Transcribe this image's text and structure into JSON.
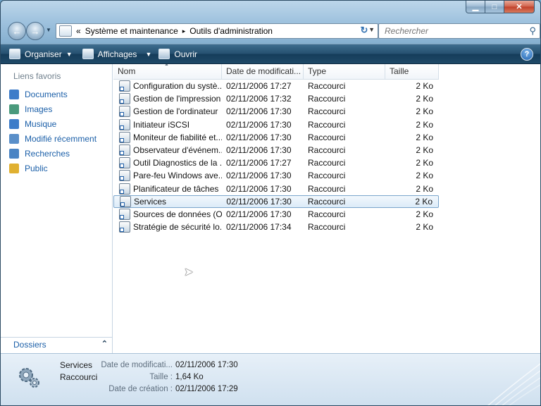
{
  "address": {
    "prefix": "«",
    "crumbs": [
      "Système et maintenance",
      "Outils d'administration"
    ],
    "separator": "▸"
  },
  "search": {
    "placeholder": "Rechercher"
  },
  "toolbar": {
    "organize": "Organiser",
    "views": "Affichages",
    "open": "Ouvrir"
  },
  "nav": {
    "header": "Liens favoris",
    "items": [
      {
        "label": "Documents",
        "color": "#3d7cc9"
      },
      {
        "label": "Images",
        "color": "#4a9a7c"
      },
      {
        "label": "Musique",
        "color": "#3d7cc9"
      },
      {
        "label": "Modifié récemment",
        "color": "#5a8fc9"
      },
      {
        "label": "Recherches",
        "color": "#4a84c4"
      },
      {
        "label": "Public",
        "color": "#e0b030"
      }
    ],
    "folders": "Dossiers"
  },
  "columns": {
    "name": "Nom",
    "date": "Date de modificati...",
    "type": "Type",
    "size": "Taille"
  },
  "files": [
    {
      "name": "Configuration du systè...",
      "date": "02/11/2006 17:27",
      "type": "Raccourci",
      "size": "2 Ko"
    },
    {
      "name": "Gestion de l'impression",
      "date": "02/11/2006 17:32",
      "type": "Raccourci",
      "size": "2 Ko"
    },
    {
      "name": "Gestion de l'ordinateur",
      "date": "02/11/2006 17:30",
      "type": "Raccourci",
      "size": "2 Ko"
    },
    {
      "name": "Initiateur iSCSI",
      "date": "02/11/2006 17:30",
      "type": "Raccourci",
      "size": "2 Ko"
    },
    {
      "name": "Moniteur de fiabilité et...",
      "date": "02/11/2006 17:30",
      "type": "Raccourci",
      "size": "2 Ko"
    },
    {
      "name": "Observateur d'événem...",
      "date": "02/11/2006 17:30",
      "type": "Raccourci",
      "size": "2 Ko"
    },
    {
      "name": "Outil Diagnostics de la ...",
      "date": "02/11/2006 17:27",
      "type": "Raccourci",
      "size": "2 Ko"
    },
    {
      "name": "Pare-feu Windows ave...",
      "date": "02/11/2006 17:30",
      "type": "Raccourci",
      "size": "2 Ko"
    },
    {
      "name": "Planificateur de tâches",
      "date": "02/11/2006 17:30",
      "type": "Raccourci",
      "size": "2 Ko"
    },
    {
      "name": "Services",
      "date": "02/11/2006 17:30",
      "type": "Raccourci",
      "size": "2 Ko"
    },
    {
      "name": "Sources de données (O...",
      "date": "02/11/2006 17:30",
      "type": "Raccourci",
      "size": "2 Ko"
    },
    {
      "name": "Stratégie de sécurité lo...",
      "date": "02/11/2006 17:34",
      "type": "Raccourci",
      "size": "2 Ko"
    }
  ],
  "details": {
    "name": "Services",
    "type": "Raccourci",
    "modified_label": "Date de modificati...",
    "modified_value": "02/11/2006 17:30",
    "size_label": "Taille :",
    "size_value": "1,64 Ko",
    "created_label": "Date de création :",
    "created_value": "02/11/2006 17:29"
  }
}
